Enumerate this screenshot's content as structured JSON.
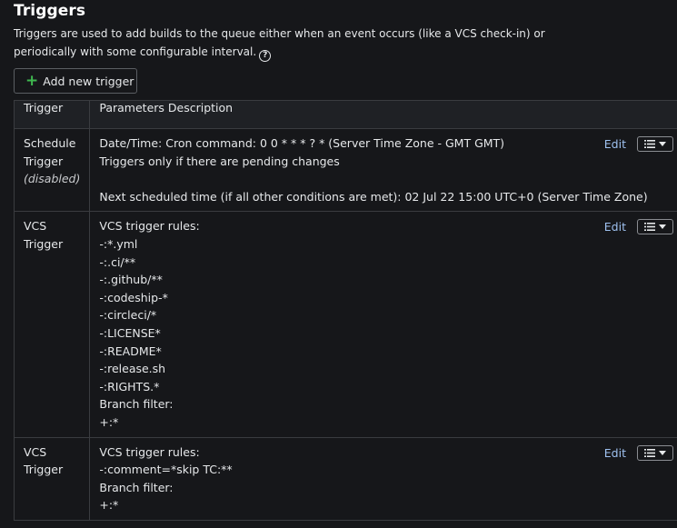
{
  "header": {
    "title": "Triggers",
    "description": "Triggers are used to add builds to the queue either when an event occurs (like a VCS check-in) or periodically with some configurable interval."
  },
  "add_button": {
    "label": "Add new trigger"
  },
  "table": {
    "columns": [
      "Trigger",
      "Parameters Description"
    ],
    "edit_label": "Edit",
    "rows": [
      {
        "type_lines": [
          "Schedule",
          "Trigger"
        ],
        "status": "(disabled)",
        "params": {
          "line1": "Date/Time: Cron command: 0 0 * * * ? * (Server Time Zone - GMT GMT)",
          "line2": "Triggers only if there are pending changes",
          "line3": "Next scheduled time (if all other conditions are met): 02 Jul 22 15:00 UTC+0 (Server Time Zone)"
        }
      },
      {
        "type_lines": [
          "VCS",
          "Trigger"
        ],
        "rules_heading": "VCS trigger rules:",
        "rules": [
          "-:*.yml",
          "-:.ci/**",
          "-:.github/**",
          "-:codeship-*",
          "-:circleci/*",
          "-:LICENSE*",
          "-:README*",
          "-:release.sh",
          "-:RIGHTS.*"
        ],
        "branch_heading": "Branch filter:",
        "branch": "+:*"
      },
      {
        "type_lines": [
          "VCS",
          "Trigger"
        ],
        "rules_heading": "VCS trigger rules:",
        "rules": [
          "-:comment=*skip TC:**"
        ],
        "branch_heading": "Branch filter:",
        "branch": "+:*"
      }
    ]
  },
  "colors": {
    "background": "#16171a",
    "link": "#9ec1f0",
    "add_icon": "#3fb950"
  }
}
